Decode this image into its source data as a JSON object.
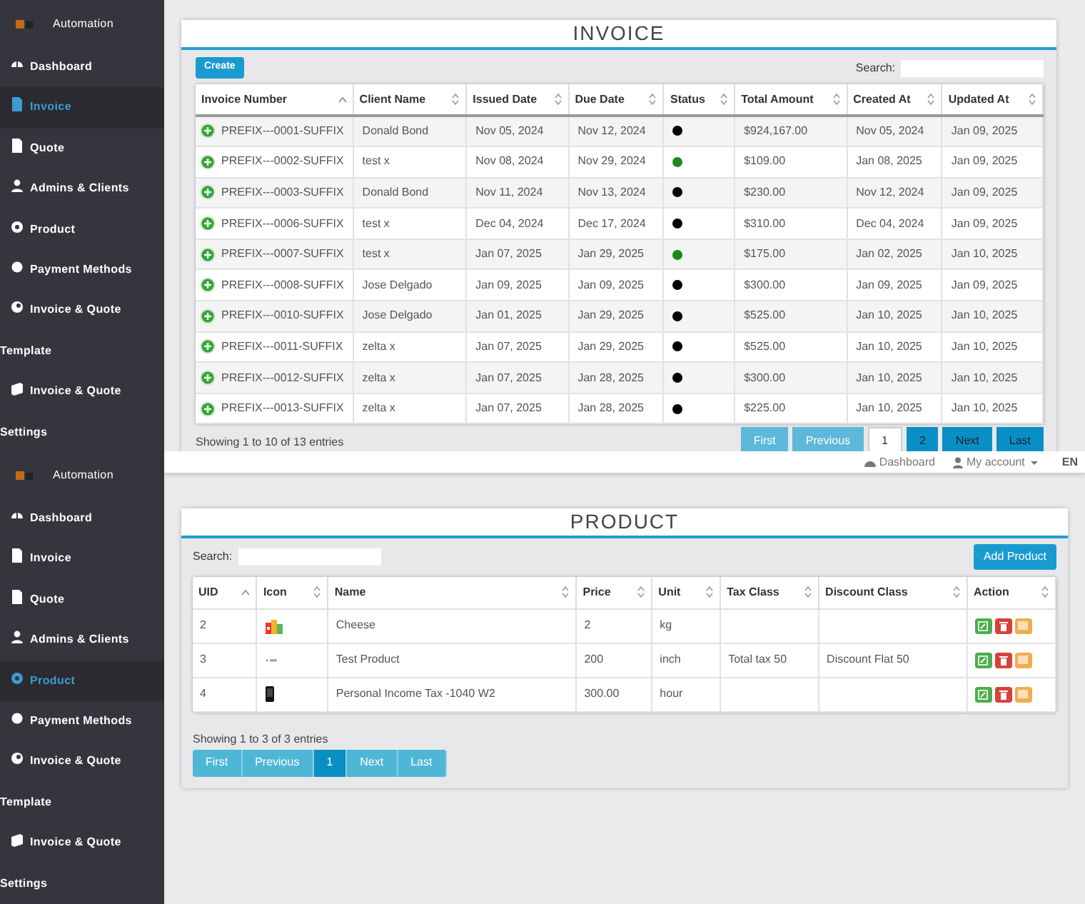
{
  "invoice_screen": {
    "sidebar": {
      "brand": "Automation",
      "items": [
        {
          "label": "Dashboard",
          "selected": false
        },
        {
          "label": "Invoice",
          "selected": true
        },
        {
          "label": "Quote",
          "selected": false
        },
        {
          "label": "Admins & Clients",
          "selected": false
        },
        {
          "label": "Product",
          "selected": false
        },
        {
          "label": "Payment Methods",
          "selected": false
        },
        {
          "label": "Invoice & Quote",
          "label_continued": "Template",
          "selected": false
        },
        {
          "label": "Invoice & Quote",
          "label_continued": "Settings",
          "selected": false
        }
      ]
    },
    "title": "INVOICE",
    "create_button": "Create",
    "search_label": "Search:",
    "table": {
      "columns": [
        {
          "label": "Invoice Number",
          "sorted": true
        },
        {
          "label": "Client Name",
          "sorted": false
        },
        {
          "label": "Issued Date",
          "sorted": false
        },
        {
          "label": "Due Date",
          "sorted": false
        },
        {
          "label": "Status",
          "sorted": false
        },
        {
          "label": "Total Amount",
          "sorted": false
        },
        {
          "label": "Created At",
          "sorted": false
        },
        {
          "label": "Updated At",
          "sorted": false
        }
      ],
      "rows": [
        {
          "number": "PREFIX---0001-SUFFIX",
          "client": "Donald Bond",
          "issued": "Nov 05, 2024",
          "due": "Nov 12, 2024",
          "color": "#000000",
          "total": "$924,167.00",
          "created": "Nov 05, 2024",
          "updated": "Jan 09, 2025"
        },
        {
          "number": "PREFIX---0002-SUFFIX",
          "client": "test x",
          "issued": "Nov 08, 2024",
          "due": "Nov 29, 2024",
          "color": "#1a8a1a",
          "total": "$109.00",
          "created": "Jan 08, 2025",
          "updated": "Jan 09, 2025"
        },
        {
          "number": "PREFIX---0003-SUFFIX",
          "client": "Donald Bond",
          "issued": "Nov 11, 2024",
          "due": "Nov 13, 2024",
          "color": "#000000",
          "total": "$230.00",
          "created": "Nov 12, 2024",
          "updated": "Jan 09, 2025"
        },
        {
          "number": "PREFIX---0006-SUFFIX",
          "client": "test x",
          "issued": "Dec 04, 2024",
          "due": "Dec 17, 2024",
          "color": "#000000",
          "total": "$310.00",
          "created": "Dec 04, 2024",
          "updated": "Jan 09, 2025"
        },
        {
          "number": "PREFIX---0007-SUFFIX",
          "client": "test x",
          "issued": "Jan 07, 2025",
          "due": "Jan 29, 2025",
          "color": "#1a8a1a",
          "total": "$175.00",
          "created": "Jan 02, 2025",
          "updated": "Jan 10, 2025"
        },
        {
          "number": "PREFIX---0008-SUFFIX",
          "client": "Jose Delgado",
          "issued": "Jan 09, 2025",
          "due": "Jan 09, 2025",
          "color": "#000000",
          "total": "$300.00",
          "created": "Jan 09, 2025",
          "updated": "Jan 09, 2025"
        },
        {
          "number": "PREFIX---0010-SUFFIX",
          "client": "Jose Delgado",
          "issued": "Jan 01, 2025",
          "due": "Jan 29, 2025",
          "color": "#000000",
          "total": "$525.00",
          "created": "Jan 10, 2025",
          "updated": "Jan 10, 2025"
        },
        {
          "number": "PREFIX---0011-SUFFIX",
          "client": "zelta x",
          "issued": "Jan 07, 2025",
          "due": "Jan 29, 2025",
          "color": "#000000",
          "total": "$525.00",
          "created": "Jan 10, 2025",
          "updated": "Jan 10, 2025"
        },
        {
          "number": "PREFIX---0012-SUFFIX",
          "client": "zelta x",
          "issued": "Jan 07, 2025",
          "due": "Jan 28, 2025",
          "color": "#000000",
          "total": "$300.00",
          "created": "Jan 10, 2025",
          "updated": "Jan 10, 2025"
        },
        {
          "number": "PREFIX---0013-SUFFIX",
          "client": "zelta x",
          "issued": "Jan 07, 2025",
          "due": "Jan 28, 2025",
          "color": "#000000",
          "total": "$225.00",
          "created": "Jan 10, 2025",
          "updated": "Jan 10, 2025"
        }
      ]
    },
    "info": "Showing 1 to 10 of 13 entries",
    "pagination": {
      "kind": "outline",
      "pages": [
        {
          "label": "First",
          "disabled": true,
          "selected": false
        },
        {
          "label": "Previous",
          "disabled": true,
          "selected": false
        },
        {
          "label": "1",
          "disabled": false,
          "selected": true
        },
        {
          "label": "2",
          "disabled": false,
          "selected": false
        },
        {
          "label": "Next",
          "disabled": false,
          "selected": false
        },
        {
          "label": "Last",
          "disabled": false,
          "selected": false
        }
      ]
    }
  },
  "product_screen": {
    "topbar": {
      "dashboard_link": "Dashboard",
      "account_menu": "My account",
      "language": "EN"
    },
    "sidebar": {
      "brand": "Automation",
      "items": [
        {
          "label": "Dashboard",
          "selected": false
        },
        {
          "label": "Invoice",
          "selected": false
        },
        {
          "label": "Quote",
          "selected": false
        },
        {
          "label": "Admins & Clients",
          "selected": false
        },
        {
          "label": "Product",
          "selected": true
        },
        {
          "label": "Payment Methods",
          "selected": false
        },
        {
          "label": "Invoice & Quote",
          "label_continued": "Template",
          "selected": false
        },
        {
          "label": "Invoice & Quote",
          "label_continued": "Settings",
          "selected": false
        }
      ]
    },
    "title": "PRODUCT",
    "search_label": "Search:",
    "add_button": "Add Product",
    "table": {
      "columns": [
        {
          "label": "UID",
          "sorted": true
        },
        {
          "label": "Icon",
          "sorted": false
        },
        {
          "label": "Name",
          "sorted": false
        },
        {
          "label": "Price",
          "sorted": false
        },
        {
          "label": "Unit",
          "sorted": false
        },
        {
          "label": "Tax Class",
          "sorted": false
        },
        {
          "label": "Discount Class",
          "sorted": false
        },
        {
          "label": "Action",
          "sorted": false
        }
      ],
      "rows": [
        {
          "uid": "2",
          "name": "Cheese",
          "price": "2",
          "unit": "kg"
        },
        {
          "uid": "3",
          "name": "Test Product",
          "price": "200",
          "unit": "inch",
          "tax_class": "Total tax 50",
          "discount_class": "Discount Flat 50"
        },
        {
          "uid": "4",
          "name": "Personal Income Tax -1040 W2",
          "price": "300.00",
          "unit": "hour"
        }
      ]
    },
    "info": "Showing 1 to 3 of 3 entries",
    "pagination": {
      "kind": "solid",
      "pages": [
        {
          "label": "First",
          "disabled": false,
          "selected": false
        },
        {
          "label": "Previous",
          "disabled": false,
          "selected": false
        },
        {
          "label": "1",
          "disabled": false,
          "selected": true
        },
        {
          "label": "Next",
          "disabled": false,
          "selected": false
        },
        {
          "label": "Last",
          "disabled": false,
          "selected": false
        }
      ]
    }
  }
}
